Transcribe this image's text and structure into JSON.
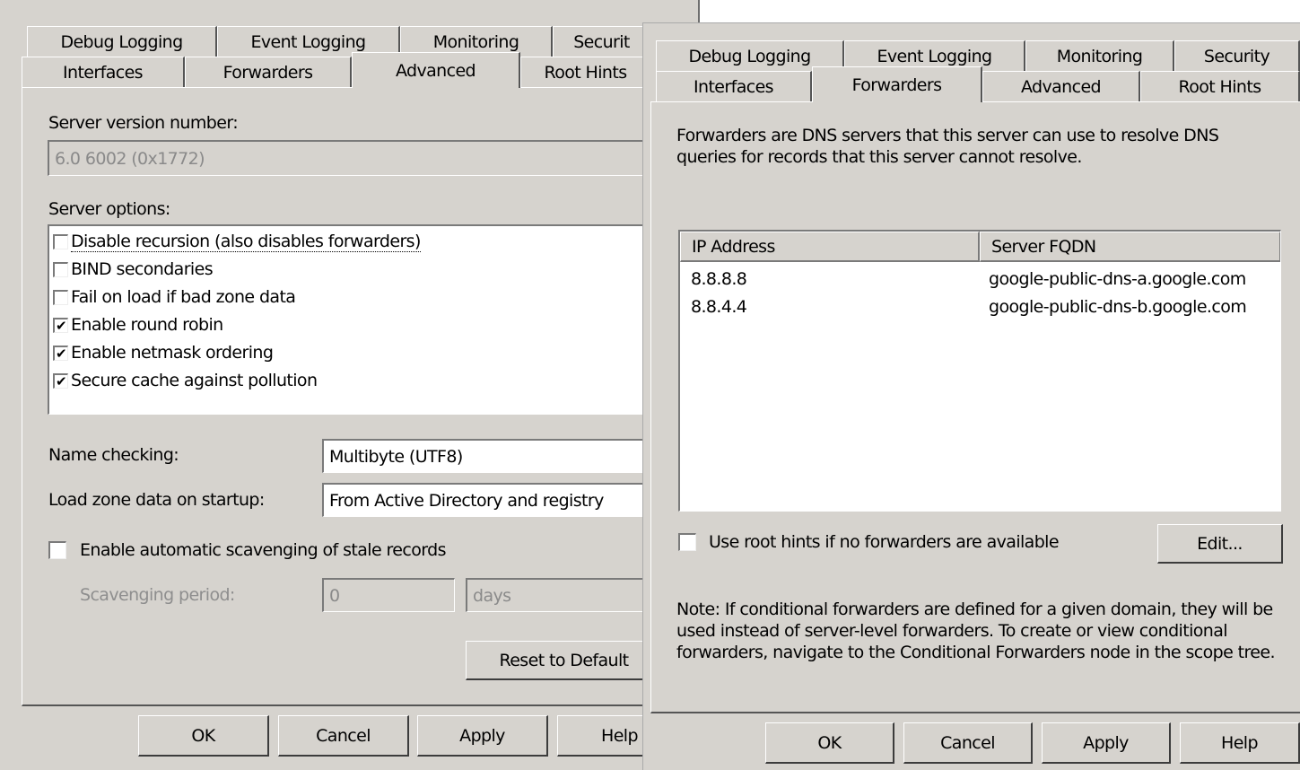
{
  "left_dialog": {
    "tabs_back": [
      "Debug Logging",
      "Event Logging",
      "Monitoring",
      "Securit"
    ],
    "tabs_front": [
      "Interfaces",
      "Forwarders",
      "Advanced",
      "Root Hints"
    ],
    "server_version_label": "Server version number:",
    "server_version_value": "6.0 6002 (0x1772)",
    "server_options_label": "Server options:",
    "options": [
      {
        "label": "Disable recursion (also disables forwarders)",
        "mark": ""
      },
      {
        "label": "BIND secondaries",
        "mark": ""
      },
      {
        "label": "Fail on load if bad zone data",
        "mark": ""
      },
      {
        "label": "Enable round robin",
        "mark": "✔"
      },
      {
        "label": "Enable netmask ordering",
        "mark": "✔"
      },
      {
        "label": "Secure cache against pollution",
        "mark": "✔"
      }
    ],
    "name_checking_label": "Name checking:",
    "name_checking_value": "Multibyte (UTF8)",
    "load_zone_label": "Load zone data on startup:",
    "load_zone_value": "From Active Directory and registry",
    "scavenging_label": "Enable automatic scavenging of stale records",
    "scavenging_period_label": "Scavenging period:",
    "scavenging_period_value": "0",
    "scavenging_unit": "days",
    "reset_button": "Reset to Default",
    "buttons": [
      "OK",
      "Cancel",
      "Apply",
      "Help"
    ]
  },
  "right_dialog": {
    "tabs_back": [
      "Debug Logging",
      "Event Logging",
      "Monitoring",
      "Security"
    ],
    "tabs_front": [
      "Interfaces",
      "Forwarders",
      "Advanced",
      "Root Hints"
    ],
    "description_line1": "Forwarders are DNS servers that this server can use to resolve DNS",
    "description_line2": "queries for records that this server cannot resolve.",
    "table": {
      "columns": [
        "IP Address",
        "Server FQDN"
      ],
      "rows": [
        [
          "8.8.8.8",
          "google-public-dns-a.google.com"
        ],
        [
          "8.8.4.4",
          "google-public-dns-b.google.com"
        ]
      ]
    },
    "root_hints_label": "Use root hints if no forwarders are available",
    "edit_button": "Edit...",
    "note_line1": "Note: If conditional forwarders are defined for a given domain, they will be",
    "note_line2": "used instead of server-level forwarders.  To create or view conditional",
    "note_line3": "forwarders, navigate to the Conditional Forwarders node in the scope tree.",
    "buttons": [
      "OK",
      "Cancel",
      "Apply",
      "Help"
    ]
  }
}
